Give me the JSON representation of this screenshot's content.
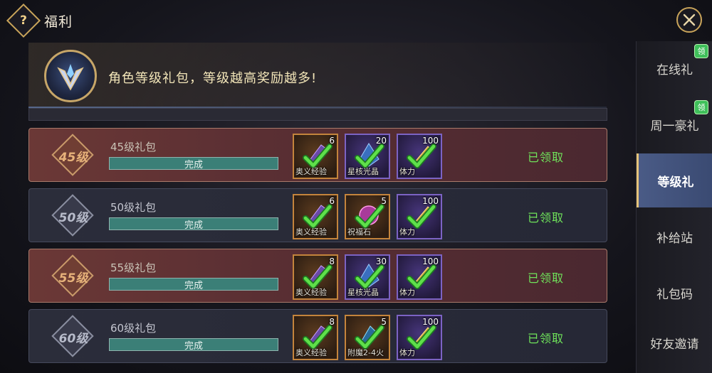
{
  "header": {
    "help_glyph": "?",
    "title": "福利"
  },
  "banner": {
    "text": "角色等级礼包，等级越高奖励越多!"
  },
  "rows": [
    {
      "level": "45级",
      "name": "45级礼包",
      "progress_text": "完成",
      "progress": 1.0,
      "style": "red",
      "status": "已领取",
      "rewards": [
        {
          "name": "奥义经验",
          "qty": "6",
          "rarity": "orange",
          "icon": "scroll-icon"
        },
        {
          "name": "星核光晶",
          "qty": "20",
          "rarity": "purple",
          "icon": "crystal-icon"
        },
        {
          "name": "体力",
          "qty": "100",
          "rarity": "purple",
          "icon": "stamina-icon"
        }
      ]
    },
    {
      "level": "50级",
      "name": "50级礼包",
      "progress_text": "完成",
      "progress": 1.0,
      "style": "dark",
      "status": "已领取",
      "rewards": [
        {
          "name": "奥义经验",
          "qty": "6",
          "rarity": "orange",
          "icon": "scroll-icon"
        },
        {
          "name": "祝福石",
          "qty": "5",
          "rarity": "orange",
          "icon": "gem-icon"
        },
        {
          "name": "体力",
          "qty": "100",
          "rarity": "purple",
          "icon": "stamina-icon"
        }
      ]
    },
    {
      "level": "55级",
      "name": "55级礼包",
      "progress_text": "完成",
      "progress": 1.0,
      "style": "red",
      "status": "已领取",
      "rewards": [
        {
          "name": "奥义经验",
          "qty": "8",
          "rarity": "orange",
          "icon": "scroll-icon"
        },
        {
          "name": "星核光晶",
          "qty": "30",
          "rarity": "purple",
          "icon": "crystal-icon"
        },
        {
          "name": "体力",
          "qty": "100",
          "rarity": "purple",
          "icon": "stamina-icon"
        }
      ]
    },
    {
      "level": "60级",
      "name": "60级礼包",
      "progress_text": "完成",
      "progress": 1.0,
      "style": "dark",
      "status": "已领取",
      "rewards": [
        {
          "name": "奥义经验",
          "qty": "8",
          "rarity": "orange",
          "icon": "scroll-icon"
        },
        {
          "name": "附魔2-4火",
          "qty": "5",
          "rarity": "orange",
          "icon": "enchant-icon"
        },
        {
          "name": "体力",
          "qty": "100",
          "rarity": "purple",
          "icon": "stamina-icon"
        }
      ]
    }
  ],
  "sidebar": {
    "items": [
      {
        "label": "在线礼",
        "badge": "领",
        "active": false
      },
      {
        "label": "周一豪礼",
        "badge": "领",
        "active": false
      },
      {
        "label": "等级礼",
        "badge": "",
        "active": true
      },
      {
        "label": "补给站",
        "badge": "",
        "active": false
      },
      {
        "label": "礼包码",
        "badge": "",
        "active": false
      },
      {
        "label": "好友邀请",
        "badge": "",
        "active": false
      }
    ]
  },
  "colors": {
    "claimed": "#6fe35a",
    "accent_gold": "#c9a45a",
    "active_tab": "#4a5b86"
  }
}
